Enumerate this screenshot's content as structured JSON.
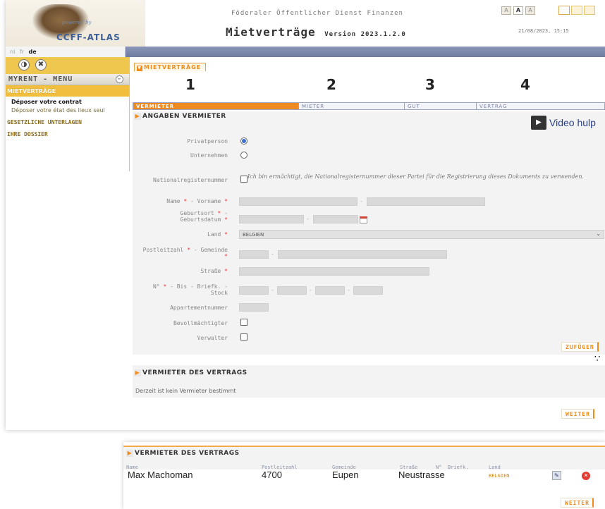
{
  "header": {
    "powered_by": "powered by",
    "logo": "CCFF-ATLAS",
    "organization": "Föderaler Öffentlicher Dienst Finanzen",
    "title": "Mietverträge",
    "version": "Version 2023.1.2.0",
    "datetime": "21/08/2023, 15:15",
    "font_sizes": [
      "A",
      "A",
      "A"
    ]
  },
  "languages": [
    {
      "code": "nl",
      "active": false
    },
    {
      "code": "fr",
      "active": false
    },
    {
      "code": "de",
      "active": true
    }
  ],
  "sidebar": {
    "menu_title": "MYRENT - MENU",
    "active_item": "MIETVERTRÄGE",
    "submenu": [
      "Déposer votre contrat",
      "Déposer votre état des lieux seul"
    ],
    "groups": [
      "GESETZLICHE UNTERLAGEN",
      "IHRE DOSSIER"
    ]
  },
  "content": {
    "page_tab": "MIETVERTRÄGE",
    "step_numbers": [
      "1",
      "2",
      "3",
      "4"
    ],
    "steps": [
      {
        "label": "VERMIETER",
        "active": true
      },
      {
        "label": "MIETER",
        "active": false
      },
      {
        "label": "GUT",
        "active": false
      },
      {
        "label": "VERTRAG",
        "active": false
      }
    ],
    "section_title": "ANGABEN VERMIETER",
    "video_help": "Video hulp",
    "form": {
      "privatperson": "Privatperson",
      "unternehmen": "Unternehmen",
      "nationalregister": "Nationalregisternummer",
      "consent": "Ich bin ermächtigt, die Nationalregisternummer dieser Partei für die Registrierung dieses Dokuments zu verwenden.",
      "name": "Name",
      "vorname": "Vorname",
      "geburtsort": "Geburtsort",
      "geburtsdatum": "Geburtsdatum",
      "land": "Land",
      "land_value": "BELGIEN",
      "postleitzahl": "Postleitzahl",
      "gemeinde": "Gemeinde",
      "strasse": "Straße",
      "nr": "N°",
      "bis": "Bis",
      "briefk": "Briefk.",
      "stock": "Stock",
      "appartement": "Appartementnummer",
      "bevollmaechtigter": "Bevollmächtigter",
      "verwalter": "Verwalter"
    },
    "add_button": "ZUFÜGEN",
    "vermieter_section_title": "VERMIETER DES VERTRAGS",
    "vermieter_empty": "Derzeit ist kein Vermieter bestimmt",
    "next_button": "WEITER"
  },
  "bottom_panel": {
    "title": "VERMIETER DES VERTRAGS",
    "columns": [
      "Name",
      "Postleitzahl",
      "Gemeinde",
      "Straße",
      "N°",
      "Briefk.",
      "Land"
    ],
    "row": {
      "name": "Max Machoman",
      "postleitzahl": "4700",
      "gemeinde": "Eupen",
      "strasse": "Neustrasse",
      "land": "BELGIEN"
    },
    "next_button": "WEITER"
  }
}
